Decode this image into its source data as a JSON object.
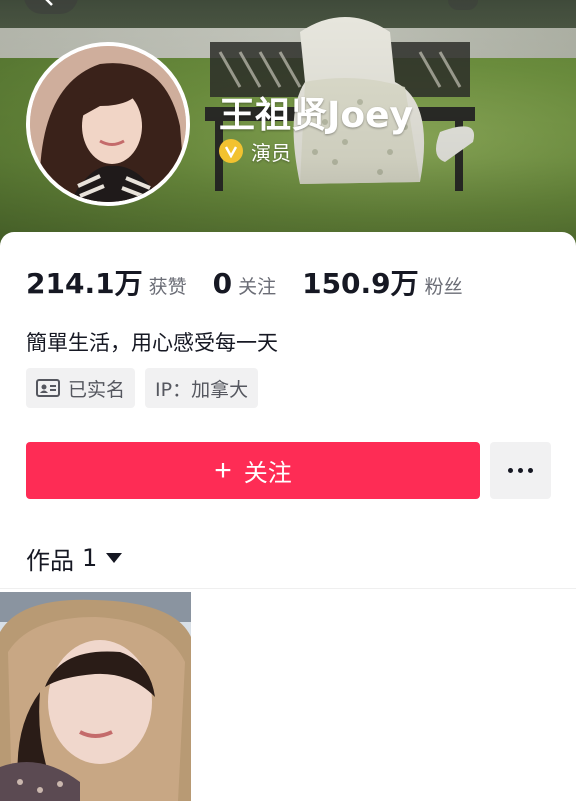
{
  "profile": {
    "name": "王祖贤Joey",
    "verify_label": "演员"
  },
  "stats": [
    {
      "value": "214.1万",
      "label": "获赞"
    },
    {
      "value": "0",
      "label": "关注"
    },
    {
      "value": "150.9万",
      "label": "粉丝"
    }
  ],
  "bio": "簡單生活，用心感受每一天",
  "tags": {
    "real_name": "已实名",
    "ip": "IP：加拿大"
  },
  "actions": {
    "follow_label": "关注"
  },
  "works": {
    "label": "作品",
    "count": "1"
  },
  "colors": {
    "accent": "#fe2c55",
    "verify_badge": "#f2c230",
    "tag_bg": "#f1f1f2"
  },
  "icons": [
    "back-arrow-icon",
    "verified-v-icon",
    "id-card-icon",
    "plus-icon",
    "more-dots-icon",
    "caret-down-icon"
  ]
}
